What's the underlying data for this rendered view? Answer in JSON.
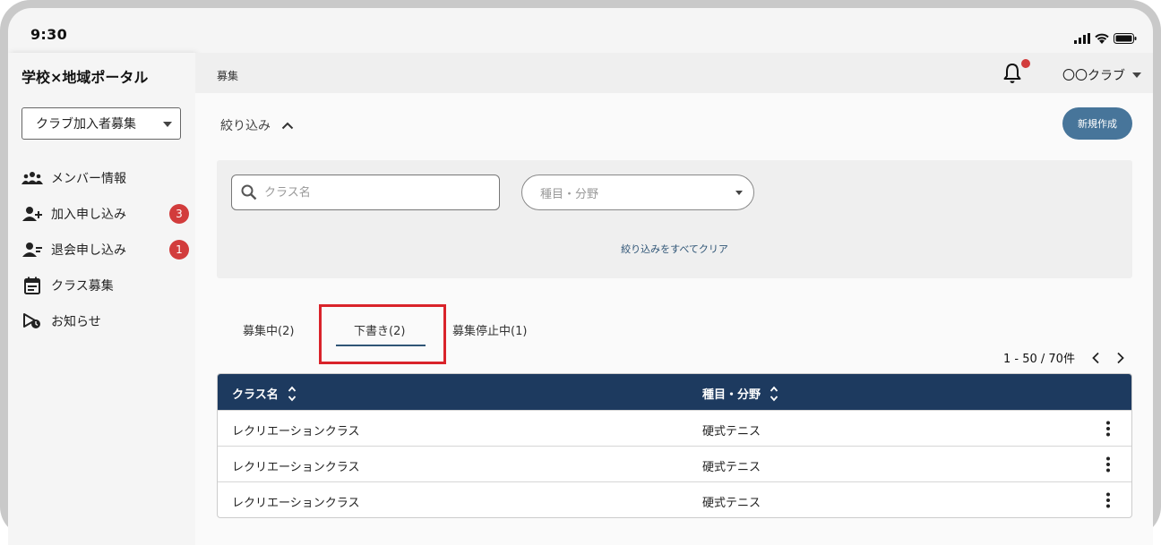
{
  "status_bar": {
    "time": "9:30"
  },
  "sidebar": {
    "app_title": "学校×地域ポータル",
    "select_value": "クラブ加入者募集",
    "items": [
      {
        "label": "メンバー情報",
        "icon": "group-icon"
      },
      {
        "label": "加入申し込み",
        "icon": "person-add-icon",
        "badge": "3"
      },
      {
        "label": "退会申し込み",
        "icon": "person-remove-icon",
        "badge": "1"
      },
      {
        "label": "クラス募集",
        "icon": "calendar-icon"
      },
      {
        "label": "お知らせ",
        "icon": "announcement-icon"
      }
    ]
  },
  "header": {
    "breadcrumb": "募集",
    "account": "〇〇クラブ"
  },
  "filters": {
    "toggle_label": "絞り込み",
    "new_button": "新規作成",
    "search_placeholder": "クラス名",
    "category_placeholder": "種目・分野",
    "clear_label": "絞り込みをすべてクリア"
  },
  "tabs": [
    {
      "label": "募集中(2)"
    },
    {
      "label": "下書き(2)",
      "active": true
    },
    {
      "label": "募集停止中(1)"
    }
  ],
  "pagination": {
    "range": "1 - 50 / 70件"
  },
  "table": {
    "headers": [
      "クラス名",
      "種目・分野"
    ],
    "rows": [
      [
        "レクリエーションクラス",
        "硬式テニス"
      ],
      [
        "レクリエーションクラス",
        "硬式テニス"
      ],
      [
        "レクリエーションクラス",
        "硬式テニス"
      ]
    ]
  },
  "colors": {
    "header_bg": "#1d3a5f",
    "accent_button": "#47759a",
    "badge": "#d23c3c",
    "highlight": "#d9232a"
  }
}
